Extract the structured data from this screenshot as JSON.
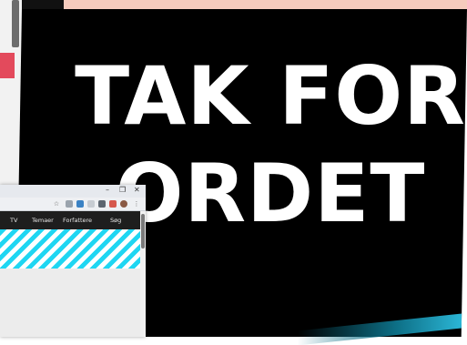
{
  "slide": {
    "headline_line1": "TAK FOR",
    "headline_line2": "ORDET",
    "background_color": "#000000",
    "text_color": "#ffffff"
  },
  "browser": {
    "window_controls": [
      "–",
      "❐",
      "✕"
    ],
    "toolbar_icons": [
      "star-icon",
      "extension-icon",
      "profile-icon",
      "menu-icon"
    ],
    "nav": {
      "items": [
        "TV",
        "Temaer",
        "Forfattere",
        "Søg"
      ]
    },
    "hero_colors": [
      "#1fd6f2",
      "#ffffff"
    ]
  },
  "colors": {
    "pink_strip": "#f6cbbd",
    "accent_red": "#e34a5c",
    "accent_cyan": "#2bb6d6"
  }
}
